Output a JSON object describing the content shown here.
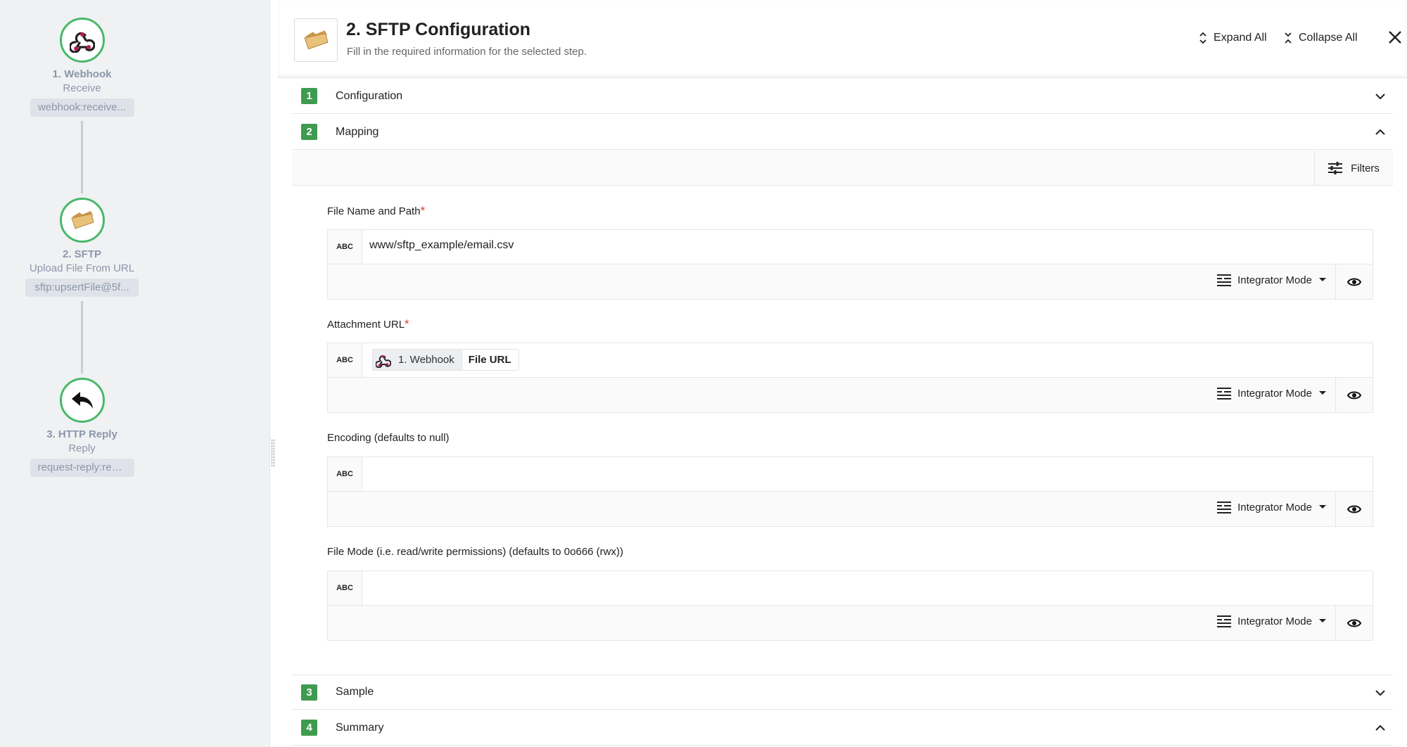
{
  "flow": {
    "steps": [
      {
        "title": "1. Webhook",
        "subtitle": "Receive",
        "tag": "webhook:receive...",
        "icon": "webhook-icon"
      },
      {
        "title": "2. SFTP",
        "subtitle": "Upload File From URL",
        "tag": "sftp:upsertFile@5f...",
        "icon": "folder-icon"
      },
      {
        "title": "3. HTTP Reply",
        "subtitle": "Reply",
        "tag": "request-reply:reply...",
        "icon": "reply-arrow-icon"
      }
    ]
  },
  "header": {
    "title": "2. SFTP Configuration",
    "subtitle": "Fill in the required information for the selected step.",
    "expand_all": "Expand All",
    "collapse_all": "Collapse All"
  },
  "sections": [
    {
      "number": "1",
      "label": "Configuration",
      "state": "collapsed"
    },
    {
      "number": "2",
      "label": "Mapping",
      "state": "expanded"
    },
    {
      "number": "3",
      "label": "Sample",
      "state": "collapsed"
    },
    {
      "number": "4",
      "label": "Summary",
      "state": "expanded"
    }
  ],
  "mapping": {
    "filters_label": "Filters",
    "type_badge": "ABC",
    "mode_label": "Integrator Mode",
    "fields": [
      {
        "label": "File Name and Path",
        "required": true,
        "value": "www/sftp_example/email.csv"
      },
      {
        "label": "Attachment URL",
        "required": true,
        "pill": {
          "step": "1. Webhook",
          "field": "File URL"
        }
      },
      {
        "label": "Encoding (defaults to null)",
        "required": false,
        "value": ""
      },
      {
        "label": "File Mode (i.e. read/write permissions) (defaults to 0o666 (rwx))",
        "required": false,
        "value": ""
      }
    ]
  },
  "colors": {
    "accent_green": "#3e9b4f",
    "node_border": "#49b86a",
    "required": "#e53935"
  }
}
